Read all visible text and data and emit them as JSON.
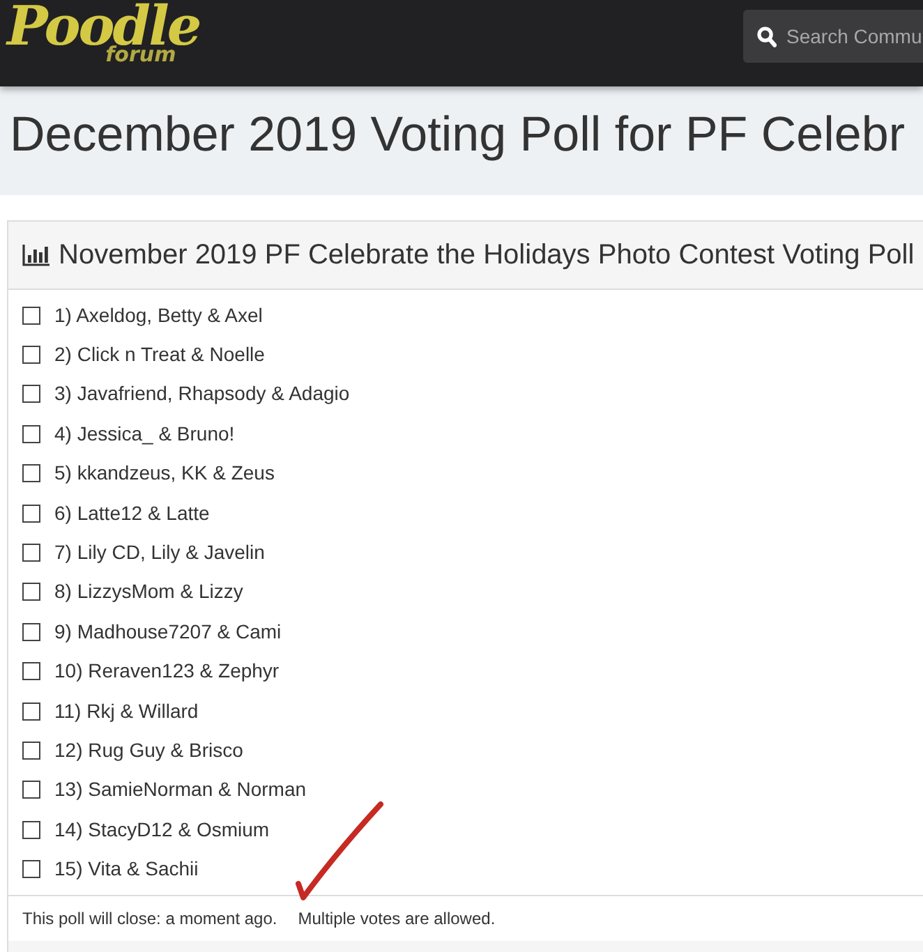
{
  "header": {
    "logo": {
      "wordmark": "Poodle",
      "tagline": "forum"
    },
    "search": {
      "placeholder": "Search Commu"
    }
  },
  "page_title": "December 2019 Voting Poll for PF Celebr",
  "poll": {
    "title": "November 2019 PF Celebrate the Holidays Photo Contest Voting Poll",
    "options": [
      {
        "label": "1) Axeldog, Betty & Axel",
        "checked": false
      },
      {
        "label": "2) Click n Treat & Noelle",
        "checked": false
      },
      {
        "label": "3) Javafriend, Rhapsody & Adagio",
        "checked": false
      },
      {
        "label": "4) Jessica_ & Bruno!",
        "checked": false
      },
      {
        "label": "5) kkandzeus, KK & Zeus",
        "checked": false
      },
      {
        "label": "6) Latte12 & Latte",
        "checked": false
      },
      {
        "label": "7) Lily CD, Lily & Javelin",
        "checked": false
      },
      {
        "label": "8) LizzysMom & Lizzy",
        "checked": false
      },
      {
        "label": "9) Madhouse7207 & Cami",
        "checked": false
      },
      {
        "label": "10) Reraven123 & Zephyr",
        "checked": false
      },
      {
        "label": "11) Rkj & Willard",
        "checked": false
      },
      {
        "label": "12) Rug Guy & Brisco",
        "checked": false
      },
      {
        "label": "13) SamieNorman & Norman",
        "checked": false
      },
      {
        "label": "14) StacyD12 & Osmium",
        "checked": false
      },
      {
        "label": "15) Vita & Sachii",
        "checked": false
      }
    ],
    "footer": {
      "close_note": "This poll will close: a moment ago.",
      "votes_note": "Multiple votes are allowed."
    }
  }
}
